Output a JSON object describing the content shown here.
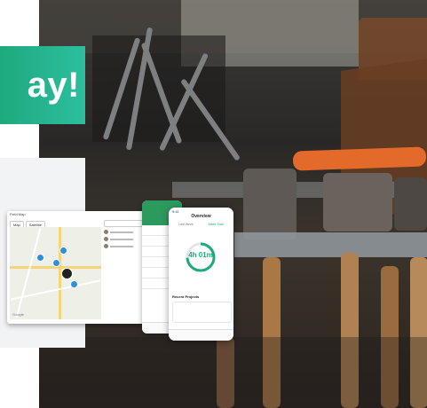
{
  "banner": {
    "text": "ay!"
  },
  "desktop": {
    "app_title": "Field Map",
    "tabs": [
      "Map",
      "Satellite"
    ],
    "map_label": "Google",
    "side_header": "Search"
  },
  "phone1": {
    "items": [
      "",
      "",
      "",
      "",
      "",
      ""
    ]
  },
  "phone2": {
    "time": "9:41",
    "title": "Overview",
    "segments": [
      "Last Week",
      "Week Total"
    ],
    "ring_value": "4h 01m",
    "section": "Recent Projects"
  },
  "colors": {
    "banner_start": "#1ea97e",
    "banner_end": "#2cbf9e",
    "accent": "#1ea97e"
  }
}
